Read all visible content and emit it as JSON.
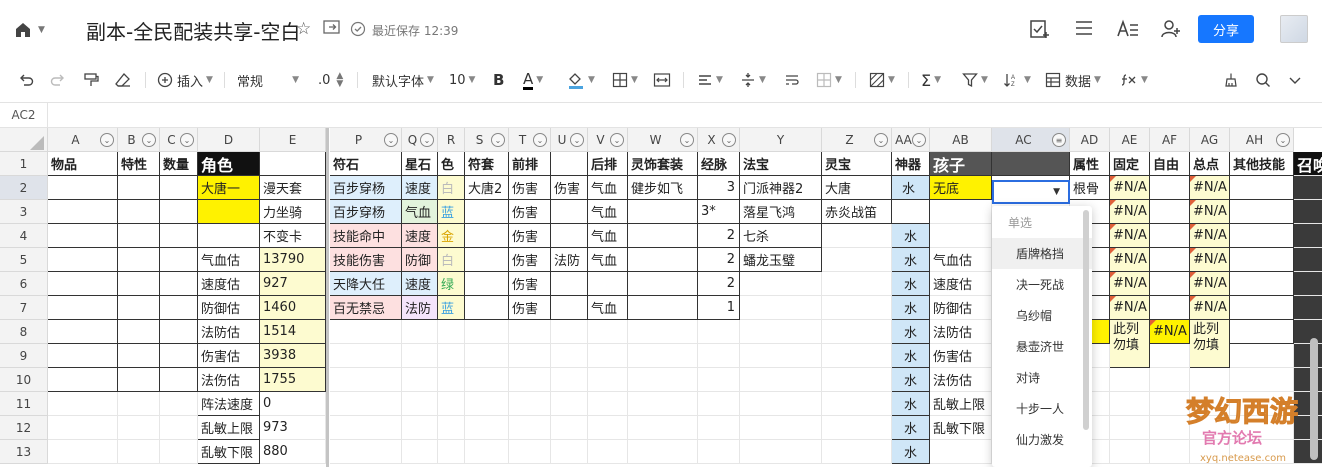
{
  "titlebar": {
    "title": "副本-全民配装共享-空白",
    "saved": "最近保存 12:39",
    "share": "分享"
  },
  "toolbar": {
    "insert": "插入",
    "format": "常规",
    "decimal": ".0",
    "font": "默认字体",
    "size": "10",
    "bold": "B",
    "fontcolor": "A",
    "data": "数据"
  },
  "formula": {
    "cellref": "AC2"
  },
  "columns": [
    "A",
    "B",
    "C",
    "D",
    "E",
    "P",
    "Q",
    "R",
    "S",
    "T",
    "U",
    "V",
    "W",
    "X",
    "Y",
    "Z",
    "AA",
    "AB",
    "AC",
    "AD",
    "AE",
    "AF",
    "AG",
    "AH"
  ],
  "rows": [
    "1",
    "2",
    "3",
    "4",
    "5",
    "6",
    "7",
    "8",
    "9",
    "10",
    "11",
    "12",
    "13"
  ],
  "header_row": {
    "A": "物品",
    "B": "特性",
    "C": "数量",
    "D": "角色",
    "P": "符石",
    "Q": "星石",
    "R": "色",
    "S": "符套",
    "T": "前排",
    "V": "后排",
    "W": "灵饰套装",
    "X": "经脉",
    "Y": "法宝",
    "Z": "灵宝",
    "AA": "神器",
    "AB": "孩子",
    "AD": "属性",
    "AE": "固定",
    "AF": "自由",
    "AG": "总点",
    "AH": "其他技能",
    "AI": "召唤"
  },
  "cells": {
    "D2": "大唐一",
    "E2": "漫天套",
    "E3": "力坐骑",
    "E4": "不变卡",
    "D5": "气血估",
    "E5": "13790",
    "D6": "速度估",
    "E6": "927",
    "D7": "防御估",
    "E7": "1460",
    "D8": "法防估",
    "E8": "1514",
    "D9": "伤害估",
    "E9": "3938",
    "D10": "法伤估",
    "E10": "1755",
    "D11": "阵法速度",
    "E11": "0",
    "D12": "乱敏上限",
    "E12": "973",
    "D13": "乱敏下限",
    "E13": "880",
    "P2": "百步穿杨",
    "P3": "百步穿杨",
    "P4": "技能命中",
    "P5": "技能伤害",
    "P6": "天降大任",
    "P7": "百无禁忌",
    "Q2": "速度",
    "Q3": "气血",
    "Q4": "速度",
    "Q5": "防御",
    "Q6": "速度",
    "Q7": "法防",
    "R2": "白",
    "R3": "蓝",
    "R4": "金",
    "R5": "白",
    "R6": "绿",
    "R7": "蓝",
    "S2": "大唐2",
    "T2": "伤害",
    "T3": "伤害",
    "T4": "伤害",
    "T5": "伤害",
    "T6": "伤害",
    "T7": "伤害",
    "U2": "伤害",
    "U5": "法防",
    "V2": "气血",
    "V3": "气血",
    "V4": "气血",
    "V5": "气血",
    "V7": "气血",
    "W2": "健步如飞",
    "X2": "3",
    "X3": "3*",
    "X4": "2",
    "X5": "2",
    "X6": "2",
    "X7": "1",
    "Y2": "门派神器2",
    "Y3": "落星飞鸿",
    "Y4": "七杀",
    "Y5": "蟠龙玉璧",
    "Z2": "大唐",
    "Z3": "赤炎战笛",
    "AA2": "水",
    "AA4": "水",
    "AA5": "水",
    "AA6": "水",
    "AA7": "水",
    "AA8": "水",
    "AA9": "水",
    "AA10": "水",
    "AA11": "水",
    "AA12": "水",
    "AA13": "水",
    "AB2": "无底",
    "AB5": "气血估",
    "AB6": "速度估",
    "AB7": "防御估",
    "AB8": "法防估",
    "AB9": "伤害估",
    "AB10": "法伤估",
    "AB11": "乱敏上限",
    "AB12": "乱敏下限",
    "AD2": "根骨",
    "AE2": "#N/A",
    "AE3": "#N/A",
    "AE4": "#N/A",
    "AE5": "#N/A",
    "AE6": "#N/A",
    "AE7": "#N/A",
    "AE8": "此列勿填",
    "AF8": "#N/A",
    "AG2": "#N/A",
    "AG3": "#N/A",
    "AG4": "#N/A",
    "AG5": "#N/A",
    "AG6": "#N/A",
    "AG7": "#N/A",
    "AG8": "此列勿填"
  },
  "dropdown": {
    "header": "单选",
    "options": [
      "盾牌格挡",
      "决一死战",
      "乌纱帽",
      "悬壶济世",
      "对诗",
      "十步一人",
      "仙力激发"
    ]
  },
  "colors": {
    "yellow": "#fff200",
    "light_yellow": "#fdfbd0",
    "light_blue": "#deeffc",
    "light_red": "#fde0e0",
    "light_purple": "#f4e4fb",
    "light_green": "#e2f3dc",
    "water_blue": "#cfe6f7",
    "header_black": "#111111",
    "accent": "#1677ff"
  },
  "watermark": {
    "text": "梦幻西游",
    "sub": "官方论坛",
    "url": "xyq.netease.com"
  }
}
